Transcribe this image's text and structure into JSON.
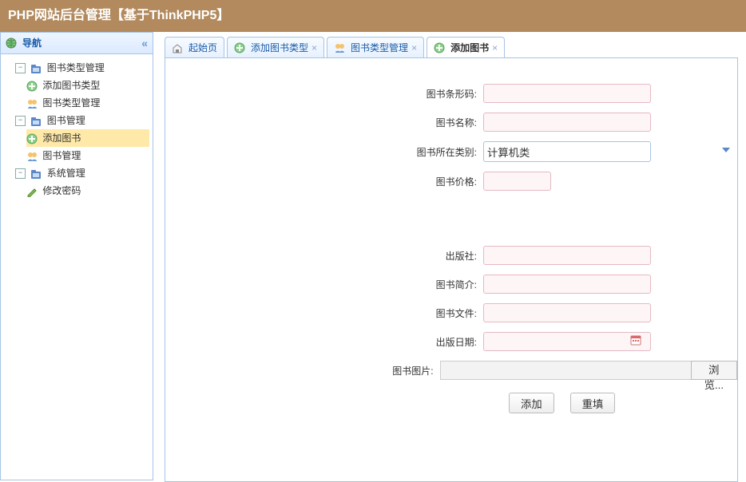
{
  "header": {
    "title": "PHP网站后台管理【基于ThinkPHP5】"
  },
  "sidebar": {
    "title": "导航",
    "nodes": [
      {
        "label": "图书类型管理",
        "children": [
          {
            "label": "添加图书类型"
          },
          {
            "label": "图书类型管理"
          }
        ]
      },
      {
        "label": "图书管理",
        "children": [
          {
            "label": "添加图书",
            "selected": true
          },
          {
            "label": "图书管理"
          }
        ]
      },
      {
        "label": "系统管理",
        "children": [
          {
            "label": "修改密码"
          }
        ]
      }
    ]
  },
  "tabs": [
    {
      "label": "起始页",
      "closable": false,
      "icon": "home"
    },
    {
      "label": "添加图书类型",
      "closable": true,
      "icon": "add"
    },
    {
      "label": "图书类型管理",
      "closable": true,
      "icon": "user"
    },
    {
      "label": "添加图书",
      "closable": true,
      "icon": "add",
      "active": true
    }
  ],
  "form": {
    "barcode": {
      "label": "图书条形码:",
      "value": ""
    },
    "name": {
      "label": "图书名称:",
      "value": ""
    },
    "category": {
      "label": "图书所在类别:",
      "value": "计算机类"
    },
    "price": {
      "label": "图书价格:",
      "value": ""
    },
    "publisher": {
      "label": "出版社:",
      "value": ""
    },
    "intro": {
      "label": "图书简介:",
      "value": ""
    },
    "file": {
      "label": "图书文件:",
      "value": ""
    },
    "pubdate": {
      "label": "出版日期:",
      "value": ""
    },
    "image": {
      "label": "图书图片:",
      "browse": "浏览..."
    }
  },
  "buttons": {
    "submit": "添加",
    "reset": "重填"
  }
}
